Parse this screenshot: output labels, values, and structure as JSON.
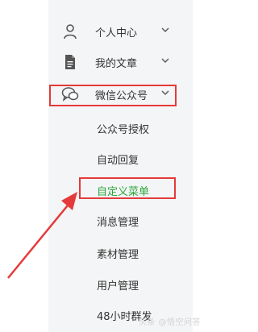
{
  "menu": {
    "top": [
      {
        "label": "个人中心",
        "icon": "user-icon"
      },
      {
        "label": "我的文章",
        "icon": "document-icon"
      },
      {
        "label": "微信公众号",
        "icon": "wechat-icon"
      }
    ],
    "sub": [
      {
        "label": "公众号授权",
        "active": false
      },
      {
        "label": "自动回复",
        "active": false
      },
      {
        "label": "自定义菜单",
        "active": true
      },
      {
        "label": "消息管理",
        "active": false
      },
      {
        "label": "素材管理",
        "active": false
      },
      {
        "label": "用户管理",
        "active": false
      },
      {
        "label": "48小时群发",
        "active": false
      }
    ]
  },
  "colors": {
    "panel_bg": "#f4f5f6",
    "text": "#333333",
    "active_text": "#2aa63a",
    "highlight": "#e53a3a"
  },
  "footer": {
    "watermark": "头条 @悟空问答"
  }
}
